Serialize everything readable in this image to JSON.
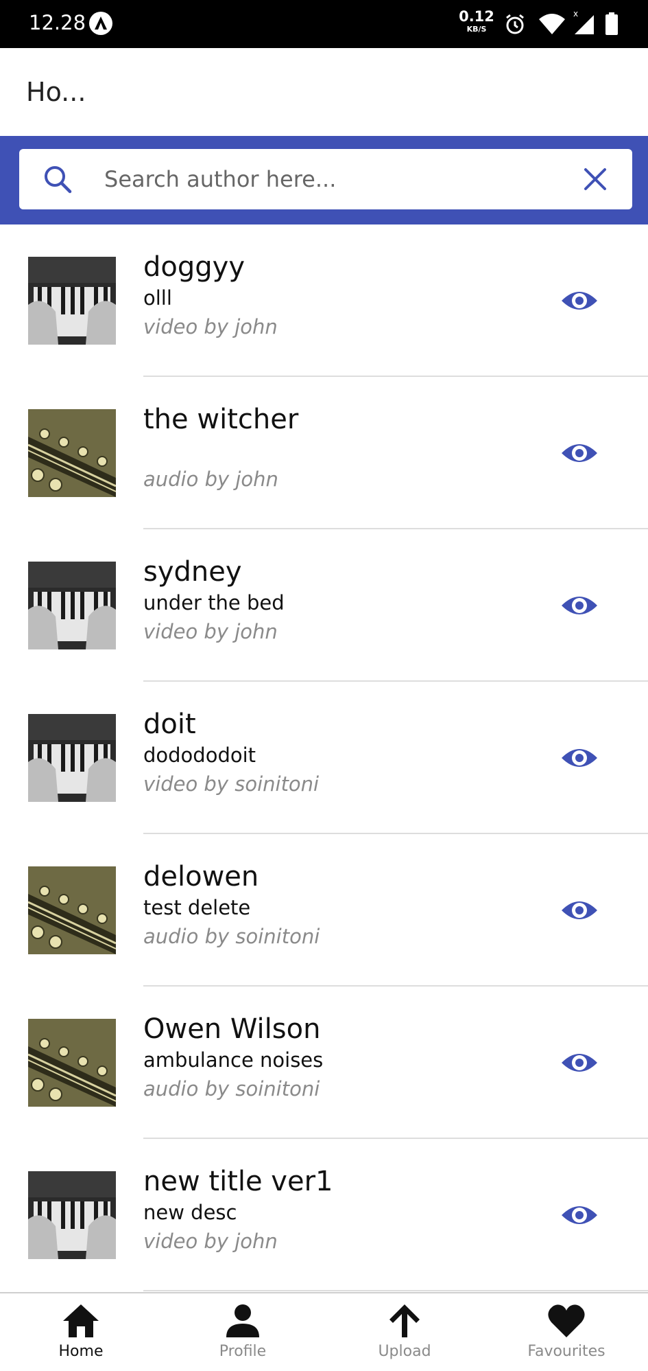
{
  "status_bar": {
    "time": "12.28",
    "net_speed_value": "0.12",
    "net_speed_unit": "KB/S"
  },
  "header": {
    "title": "Ho..."
  },
  "search": {
    "placeholder": "Search author here...",
    "value": ""
  },
  "items": [
    {
      "title": "doggyy",
      "description": "olll",
      "meta": "video by john",
      "thumbnail": "piano"
    },
    {
      "title": "the witcher",
      "description": "",
      "meta": "audio by john",
      "thumbnail": "guitar"
    },
    {
      "title": "sydney",
      "description": "under the bed",
      "meta": "video by john",
      "thumbnail": "piano"
    },
    {
      "title": "doit",
      "description": "dodododoit",
      "meta": "video by soinitoni",
      "thumbnail": "piano"
    },
    {
      "title": "delowen",
      "description": "test delete",
      "meta": "audio by soinitoni",
      "thumbnail": "guitar"
    },
    {
      "title": "Owen Wilson",
      "description": "ambulance noises",
      "meta": "audio by soinitoni",
      "thumbnail": "guitar"
    },
    {
      "title": "new title ver1",
      "description": "new desc",
      "meta": "video by john",
      "thumbnail": "piano"
    }
  ],
  "bottom_nav": [
    {
      "label": "Home",
      "icon": "home-icon",
      "active": true
    },
    {
      "label": "Profile",
      "icon": "person-icon",
      "active": false
    },
    {
      "label": "Upload",
      "icon": "upload-arrow-icon",
      "active": false
    },
    {
      "label": "Favourites",
      "icon": "heart-icon",
      "active": false
    }
  ],
  "colors": {
    "primary": "#3f51b5",
    "status_bar": "#000000",
    "text_secondary": "#8a8a8a"
  }
}
